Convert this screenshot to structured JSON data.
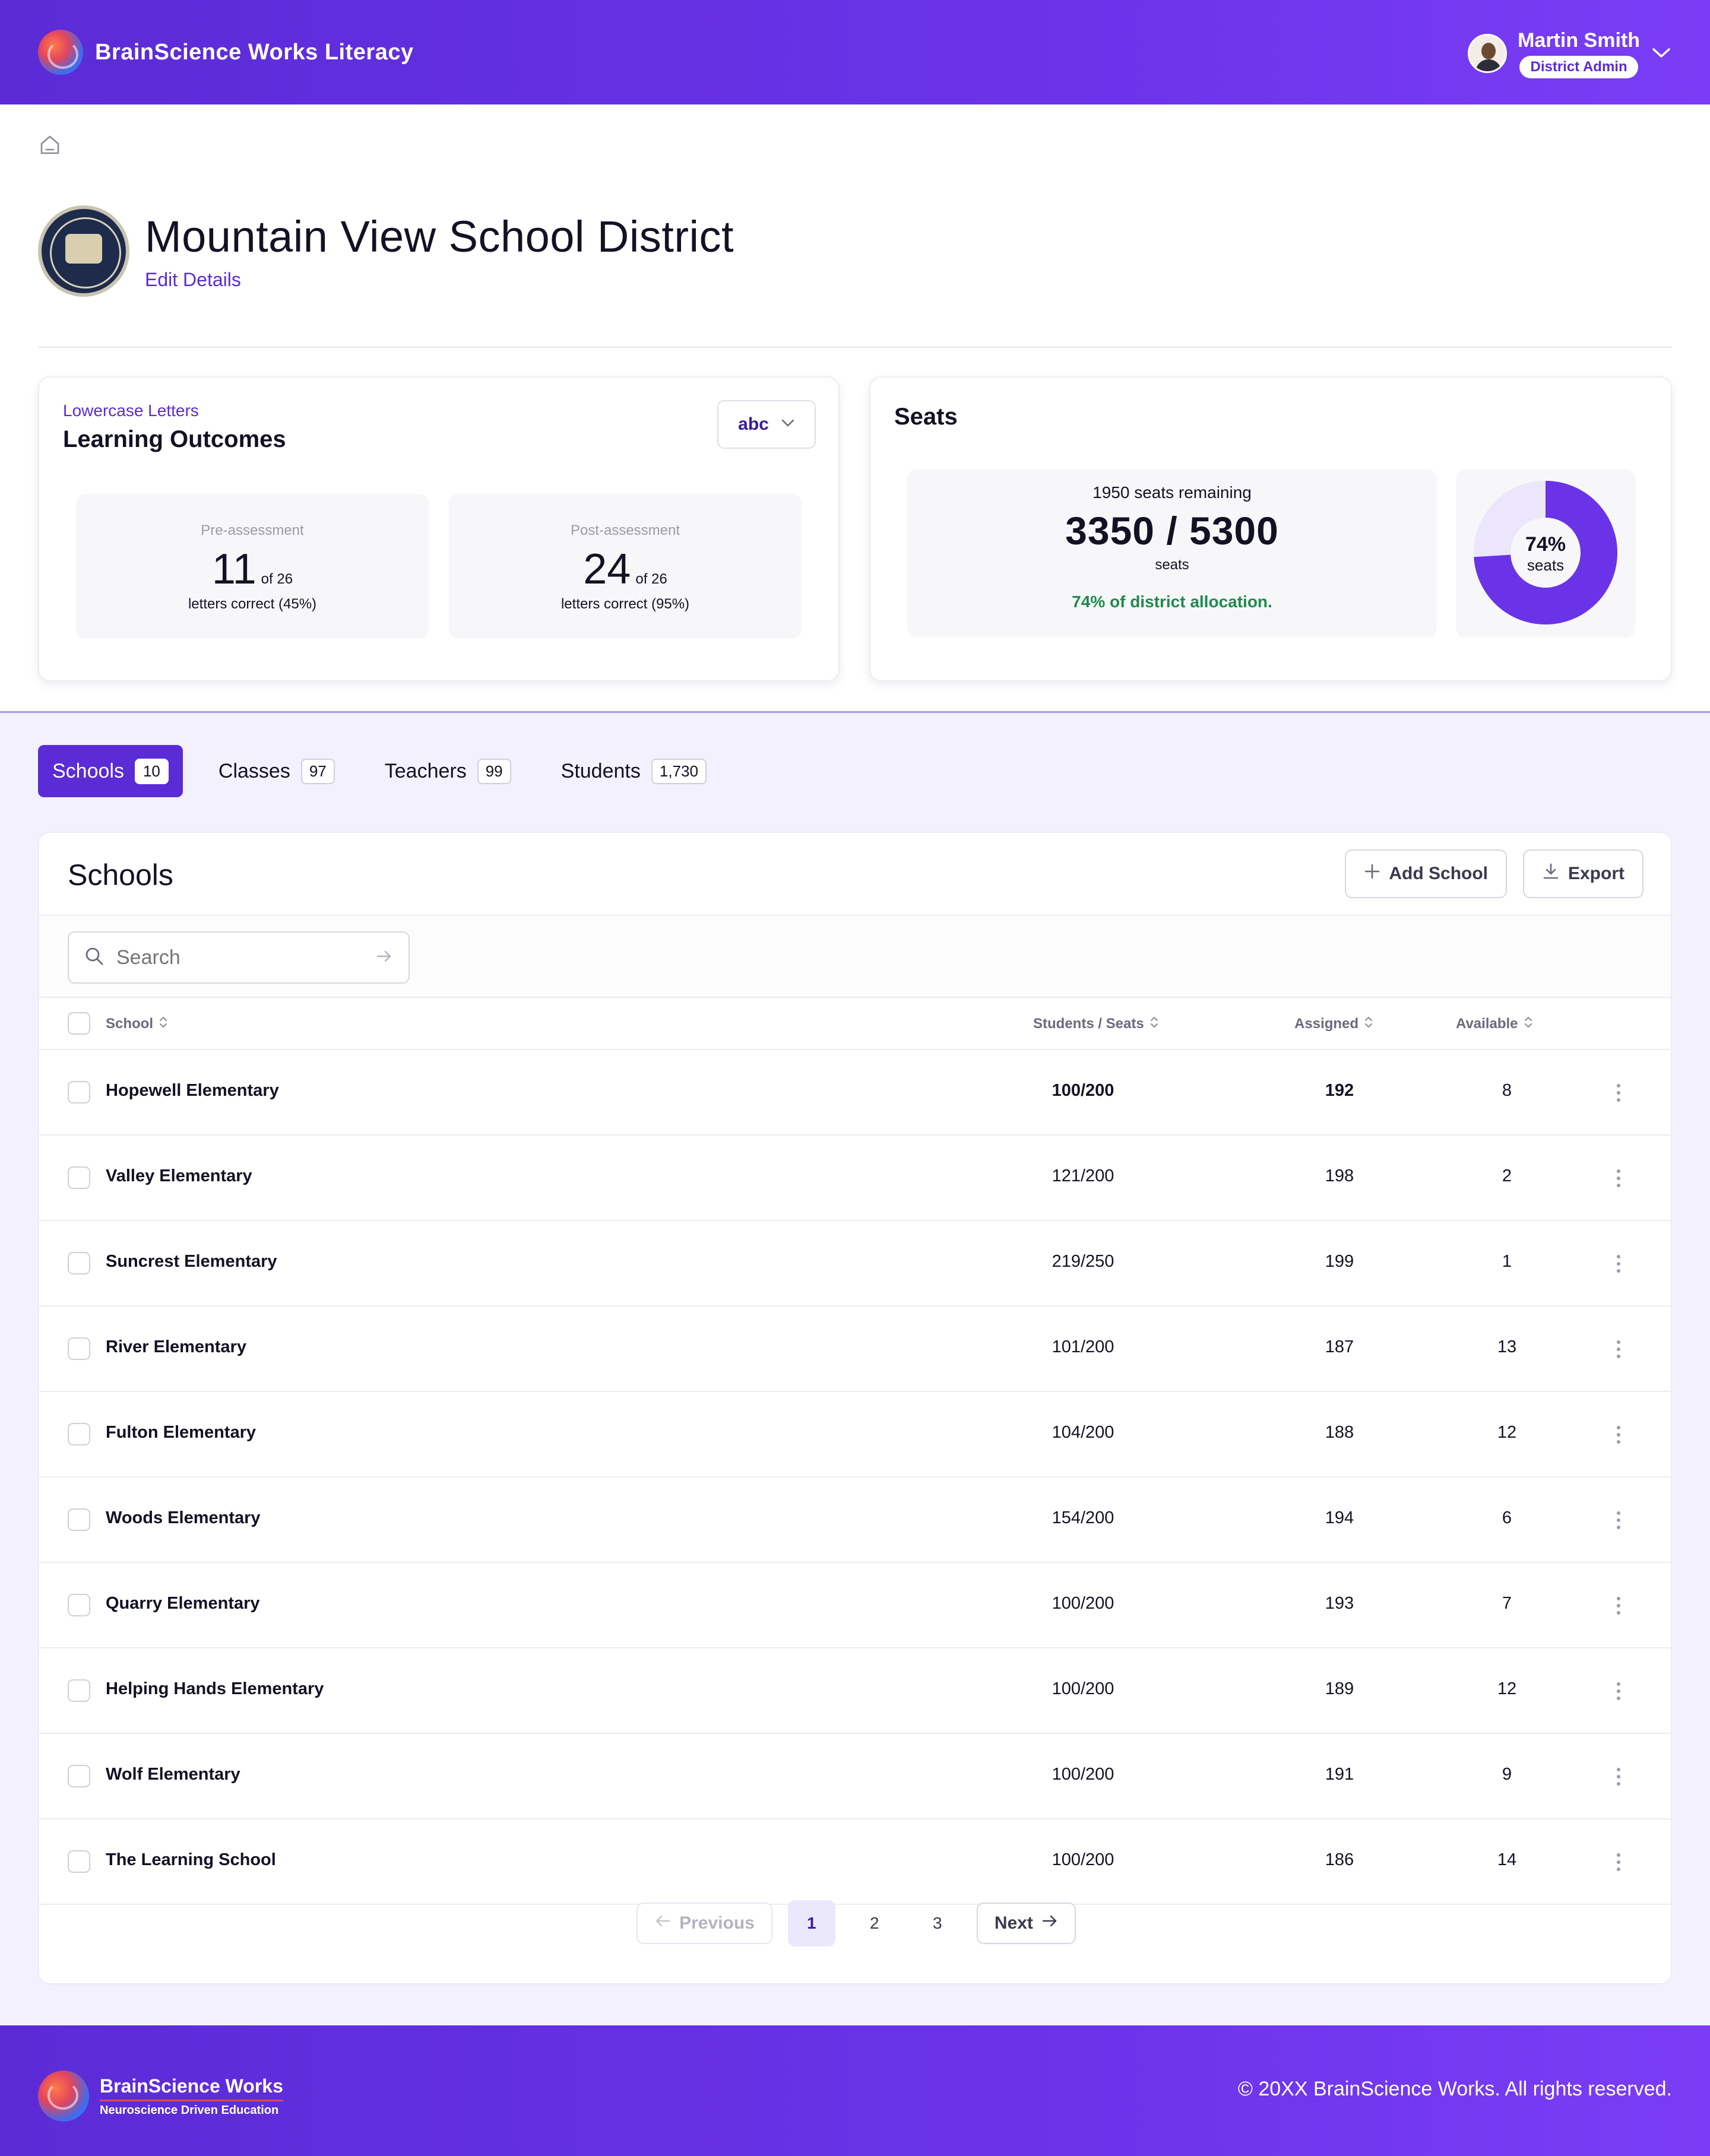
{
  "header": {
    "app_title": "BrainScience Works Literacy",
    "user_name": "Martin Smith",
    "user_role": "District Admin"
  },
  "district": {
    "name": "Mountain View School District",
    "edit_label": "Edit Details"
  },
  "outcomes": {
    "subtitle": "Lowercase Letters",
    "title": "Learning Outcomes",
    "selector_value": "abc",
    "pre": {
      "label": "Pre-assessment",
      "score": "11",
      "of": "of 26",
      "detail": "letters correct  (45%)"
    },
    "post": {
      "label": "Post-assessment",
      "score": "24",
      "of": "of 26",
      "detail": "letters correct  (95%)"
    }
  },
  "seats": {
    "title": "Seats",
    "remaining": "1950 seats remaining",
    "ratio": "3350 / 5300",
    "unit": "seats",
    "allocation": "74% of district allocation.",
    "donut_percent_label": "74%",
    "donut_unit": "seats",
    "donut_fraction": 0.74,
    "colors": {
      "filled": "#6a33e8",
      "track": "#ebe6fb"
    }
  },
  "tabs": [
    {
      "label": "Schools",
      "count": "10"
    },
    {
      "label": "Classes",
      "count": "97"
    },
    {
      "label": "Teachers",
      "count": "99"
    },
    {
      "label": "Students",
      "count": "1,730"
    }
  ],
  "table": {
    "title": "Schools",
    "add_label": "Add School",
    "export_label": "Export",
    "search_placeholder": "Search",
    "columns": {
      "school": "School",
      "students": "Students / Seats",
      "assigned": "Assigned",
      "available": "Available"
    },
    "rows": [
      {
        "school": "Hopewell Elementary",
        "students": "100/200",
        "assigned": "192",
        "available": "8"
      },
      {
        "school": "Valley Elementary",
        "students": "121/200",
        "assigned": "198",
        "available": "2"
      },
      {
        "school": "Suncrest Elementary",
        "students": "219/250",
        "assigned": "199",
        "available": "1"
      },
      {
        "school": "River Elementary",
        "students": "101/200",
        "assigned": "187",
        "available": "13"
      },
      {
        "school": "Fulton Elementary",
        "students": "104/200",
        "assigned": "188",
        "available": "12"
      },
      {
        "school": "Woods Elementary",
        "students": "154/200",
        "assigned": "194",
        "available": "6"
      },
      {
        "school": "Quarry Elementary",
        "students": "100/200",
        "assigned": "193",
        "available": "7"
      },
      {
        "school": "Helping Hands Elementary",
        "students": "100/200",
        "assigned": "189",
        "available": "12"
      },
      {
        "school": "Wolf Elementary",
        "students": "100/200",
        "assigned": "191",
        "available": "9"
      },
      {
        "school": "The Learning School",
        "students": "100/200",
        "assigned": "186",
        "available": "14"
      }
    ]
  },
  "pagination": {
    "prev_label": "Previous",
    "next_label": "Next",
    "pages": [
      "1",
      "2",
      "3"
    ]
  },
  "footer": {
    "brand": "BrainScience Works",
    "tagline": "Neuroscience Driven Education",
    "copyright": "© 20XX BrainScience Works. All rights reserved."
  }
}
